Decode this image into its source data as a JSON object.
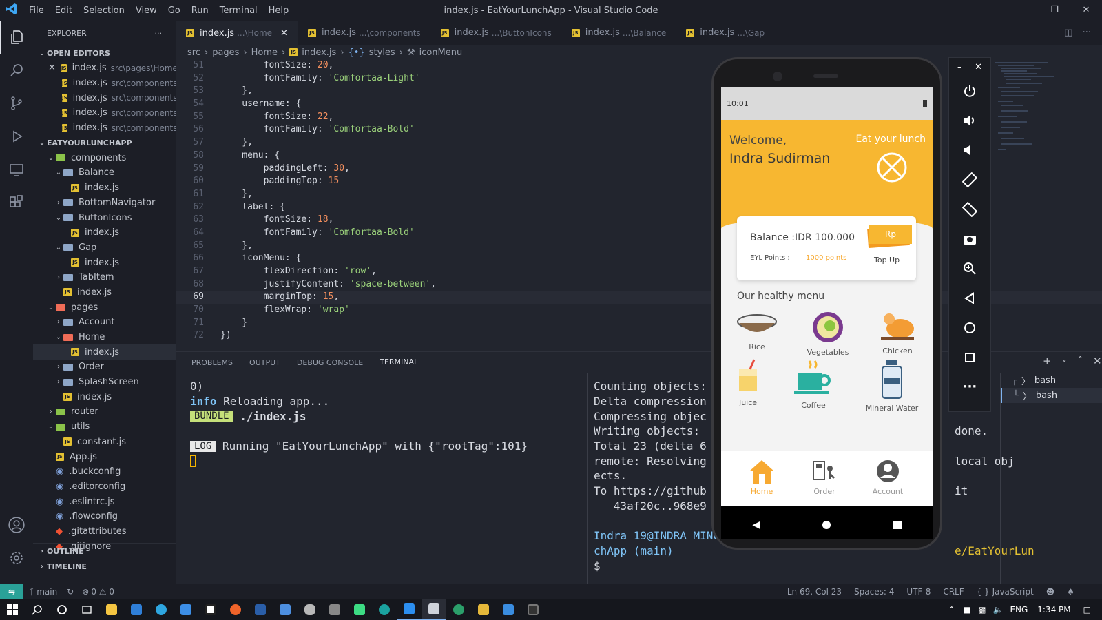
{
  "titlebar": {
    "menus": [
      "File",
      "Edit",
      "Selection",
      "View",
      "Go",
      "Run",
      "Terminal",
      "Help"
    ],
    "title": "index.js - EatYourLunchApp - Visual Studio Code"
  },
  "sidebar": {
    "header": "EXPLORER",
    "open_editors_label": "OPEN EDITORS",
    "open_editors": [
      {
        "name": "index.js",
        "path": "src\\pages\\Home"
      },
      {
        "name": "index.js",
        "path": "src\\components"
      },
      {
        "name": "index.js",
        "path": "src\\components..."
      },
      {
        "name": "index.js",
        "path": "src\\components..."
      },
      {
        "name": "index.js",
        "path": "src\\components..."
      }
    ],
    "project_label": "EATYOURLUNCHAPP",
    "tree": [
      {
        "label": "components",
        "depth": 1,
        "type": "folder",
        "open": true
      },
      {
        "label": "Balance",
        "depth": 2,
        "type": "folder",
        "open": true
      },
      {
        "label": "index.js",
        "depth": 3,
        "type": "js"
      },
      {
        "label": "BottomNavigator",
        "depth": 2,
        "type": "folder",
        "open": false
      },
      {
        "label": "ButtonIcons",
        "depth": 2,
        "type": "folder",
        "open": true
      },
      {
        "label": "index.js",
        "depth": 3,
        "type": "js"
      },
      {
        "label": "Gap",
        "depth": 2,
        "type": "folder",
        "open": true
      },
      {
        "label": "index.js",
        "depth": 3,
        "type": "js"
      },
      {
        "label": "TabItem",
        "depth": 2,
        "type": "folder",
        "open": false
      },
      {
        "label": "index.js",
        "depth": 2,
        "type": "js"
      },
      {
        "label": "pages",
        "depth": 1,
        "type": "folder",
        "open": true
      },
      {
        "label": "Account",
        "depth": 2,
        "type": "folder",
        "open": false
      },
      {
        "label": "Home",
        "depth": 2,
        "type": "folder",
        "open": true
      },
      {
        "label": "index.js",
        "depth": 3,
        "type": "js",
        "selected": true
      },
      {
        "label": "Order",
        "depth": 2,
        "type": "folder",
        "open": false
      },
      {
        "label": "SplashScreen",
        "depth": 2,
        "type": "folder",
        "open": false
      },
      {
        "label": "index.js",
        "depth": 2,
        "type": "js"
      },
      {
        "label": "router",
        "depth": 1,
        "type": "folder",
        "open": false
      },
      {
        "label": "utils",
        "depth": 1,
        "type": "folder",
        "open": true
      },
      {
        "label": "constant.js",
        "depth": 2,
        "type": "js"
      },
      {
        "label": "App.js",
        "depth": 1,
        "type": "js"
      },
      {
        "label": ".buckconfig",
        "depth": 1,
        "type": "cfg"
      },
      {
        "label": ".editorconfig",
        "depth": 1,
        "type": "cfg"
      },
      {
        "label": ".eslintrc.js",
        "depth": 1,
        "type": "cfg"
      },
      {
        "label": ".flowconfig",
        "depth": 1,
        "type": "cfg"
      },
      {
        "label": ".gitattributes",
        "depth": 1,
        "type": "git"
      },
      {
        "label": ".gitignore",
        "depth": 1,
        "type": "git"
      }
    ],
    "outline_label": "OUTLINE",
    "timeline_label": "TIMELINE"
  },
  "tabs": [
    {
      "name": "index.js",
      "path": "...\\Home",
      "active": true
    },
    {
      "name": "index.js",
      "path": "...\\components"
    },
    {
      "name": "index.js",
      "path": "...\\ButtonIcons"
    },
    {
      "name": "index.js",
      "path": "...\\Balance"
    },
    {
      "name": "index.js",
      "path": "...\\Gap"
    }
  ],
  "breadcrumbs": [
    "src",
    "pages",
    "Home",
    "index.js",
    "styles",
    "iconMenu"
  ],
  "code": [
    {
      "n": "51",
      "t": "        fontSize: 20,"
    },
    {
      "n": "52",
      "t": "        fontFamily: 'Comfortaa-Light'"
    },
    {
      "n": "53",
      "t": "    },"
    },
    {
      "n": "54",
      "t": "    username: {"
    },
    {
      "n": "55",
      "t": "        fontSize: 22,"
    },
    {
      "n": "56",
      "t": "        fontFamily: 'Comfortaa-Bold'"
    },
    {
      "n": "57",
      "t": "    },"
    },
    {
      "n": "58",
      "t": "    menu: {"
    },
    {
      "n": "59",
      "t": "        paddingLeft: 30,"
    },
    {
      "n": "60",
      "t": "        paddingTop: 15"
    },
    {
      "n": "61",
      "t": "    },"
    },
    {
      "n": "62",
      "t": "    label: {"
    },
    {
      "n": "63",
      "t": "        fontSize: 18,"
    },
    {
      "n": "64",
      "t": "        fontFamily: 'Comfortaa-Bold'"
    },
    {
      "n": "65",
      "t": "    },"
    },
    {
      "n": "66",
      "t": "    iconMenu: {"
    },
    {
      "n": "67",
      "t": "        flexDirection: 'row',"
    },
    {
      "n": "68",
      "t": "        justifyContent: 'space-between',"
    },
    {
      "n": "69",
      "t": "        marginTop: 15,",
      "current": true
    },
    {
      "n": "70",
      "t": "        flexWrap: 'wrap'"
    },
    {
      "n": "71",
      "t": "    }"
    },
    {
      "n": "72",
      "t": "})"
    }
  ],
  "panel": {
    "tabs": [
      "PROBLEMS",
      "OUTPUT",
      "DEBUG CONSOLE",
      "TERMINAL"
    ],
    "active_tab": "TERMINAL",
    "term_left": {
      "l1": "0)",
      "info": "info",
      "l2": " Reloading app...",
      "bundle": "BUNDLE",
      "l3": " ./index.js",
      "log": "LOG",
      "l4": " Running \"EatYourLunchApp\" with {\"rootTag\":101}"
    },
    "term_right": [
      "Counting objects:",
      "Delta compression",
      "Compressing objec",
      "Writing objects:",
      "Total 23 (delta 6",
      "remote: Resolving",
      "ects.",
      "To https://github",
      "   43af20c..968e9",
      "",
      "Indra 19@INDRA MING",
      "chApp (main)",
      "$ "
    ],
    "term_right_tail": [
      "done.",
      "local obj",
      "it",
      "e/EatYourLun"
    ],
    "shells": [
      "bash",
      "bash"
    ]
  },
  "status": {
    "branch": "main",
    "problems": "0 ⚠ 0",
    "errors": "⊗",
    "position": "Ln 69, Col 23",
    "spaces": "Spaces: 4",
    "encoding": "UTF-8",
    "eol": "CRLF",
    "language": "JavaScript"
  },
  "taskbar": {
    "lang": "ENG",
    "time": "1:34 PM"
  },
  "app": {
    "status_time": "10:01",
    "welcome": "Welcome,",
    "user": "Indra Sudirman",
    "brand": "Eat your lunch",
    "balance": "Balance :IDR 100.000",
    "points_label": "EYL Points :",
    "points": "1000 points",
    "topup_icon": "Rp",
    "topup": "Top Up",
    "menu_title": "Our healthy menu",
    "menu": [
      "Rice",
      "Vegetables",
      "Chicken",
      "Juice",
      "Coffee",
      "Mineral Water"
    ],
    "nav": [
      "Home",
      "Order",
      "Account"
    ],
    "accent": "#f7b731"
  }
}
